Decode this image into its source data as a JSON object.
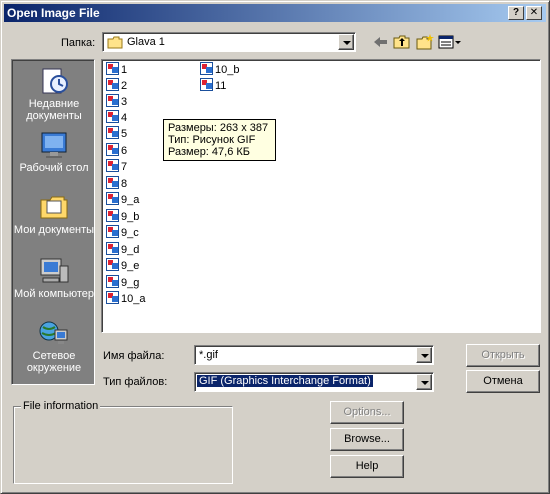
{
  "window": {
    "title": "Open Image File",
    "help_btn": "?",
    "close_btn": "✕"
  },
  "lookin": {
    "label": "Папка:",
    "value": "Glava 1"
  },
  "places": [
    {
      "label": "Недавние документы",
      "icon": "recent-documents-icon"
    },
    {
      "label": "Рабочий стол",
      "icon": "desktop-icon"
    },
    {
      "label": "Мои документы",
      "icon": "my-documents-icon"
    },
    {
      "label": "Мой компьютер",
      "icon": "my-computer-icon"
    },
    {
      "label": "Сетевое окружение",
      "icon": "network-icon"
    }
  ],
  "files": [
    "1",
    "2",
    "3",
    "4",
    "5",
    "6",
    "7",
    "8",
    "9_a",
    "9_b",
    "9_c",
    "9_d",
    "9_e",
    "9_g",
    "10_a",
    "10_b",
    "11"
  ],
  "tooltip": {
    "line1": "Размеры: 263 x 387",
    "line2": "Тип: Рисунок GIF",
    "line3": "Размер: 47,6 КБ"
  },
  "filename": {
    "label": "Имя файла:",
    "value": "*.gif"
  },
  "filetype": {
    "label": "Тип файлов:",
    "value": "GIF (Graphics Interchange Format)"
  },
  "buttons": {
    "open": "Открыть",
    "cancel": "Отмена",
    "options": "Options...",
    "browse": "Browse...",
    "help": "Help"
  },
  "file_info": {
    "legend": "File information"
  },
  "colors": {
    "face": "#d4d0c8",
    "title_start": "#0a246a",
    "title_end": "#a6caf0",
    "selection": "#0a246a"
  }
}
